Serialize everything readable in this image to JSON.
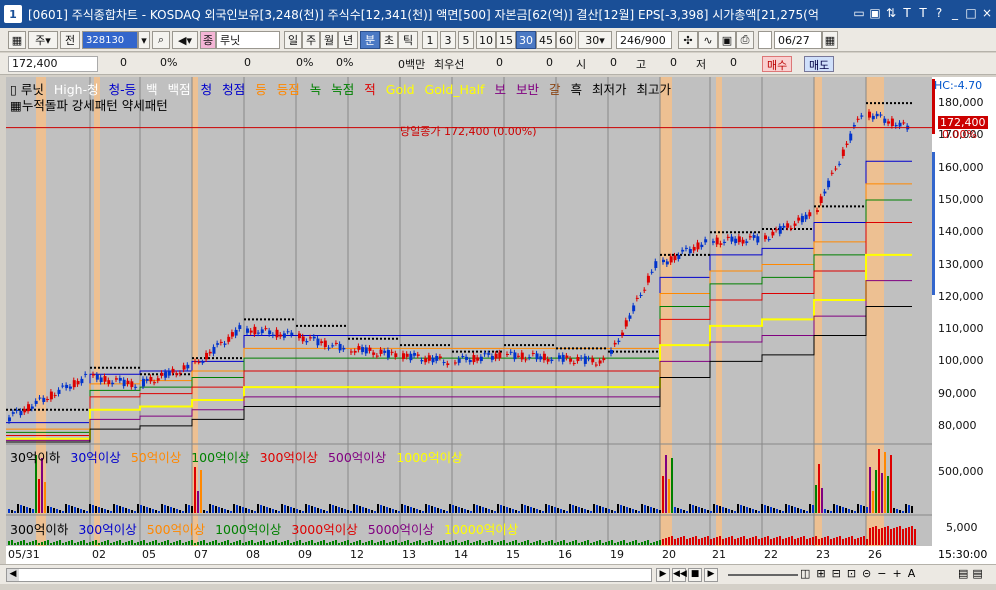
{
  "window": {
    "number": "1",
    "title": "[0601] 주식종합차트 - KOSDAQ 외국인보유[3,248(천)] 주식수[12,341(천)] 액면[500] 자본금[62(억)] 결산[12월] EPS[-3,398] 시가총액[21,275(억",
    "controls": [
      "▭",
      "▣",
      "⇅",
      "T",
      "T",
      "?",
      "_",
      "□",
      "×"
    ]
  },
  "toolbar": {
    "market": "주",
    "prev": "전",
    "code": "328130",
    "name": "루닛",
    "name_badge": "종",
    "periods": [
      "일",
      "주",
      "월",
      "년",
      "분",
      "초",
      "틱"
    ],
    "active_period": "분",
    "intervals": [
      "1",
      "3",
      "5",
      "10",
      "15",
      "30",
      "45",
      "60"
    ],
    "active_interval": "30",
    "interval_value": "30",
    "count": "246/900",
    "date": "06/27"
  },
  "inforow": {
    "price": "172,400",
    "change": "0",
    "change_pct": "0%",
    "v2": "0",
    "v2_pct": "0%",
    "v3_pct": "0%",
    "amount": "0백만",
    "priority": "최우선",
    "bid": "0",
    "ask": "0",
    "open_label": "시",
    "open": "0",
    "high_label": "고",
    "high": "0",
    "low_label": "저",
    "low": "0",
    "buy": "매수",
    "sell": "매도"
  },
  "legend_top": [
    {
      "text": "▯ 루닛",
      "color": "#000000"
    },
    {
      "text": "High-청",
      "color": "#ffffff"
    },
    {
      "text": "청-등",
      "color": "#0000cc"
    },
    {
      "text": "백",
      "color": "#ffffff"
    },
    {
      "text": "백점",
      "color": "#ffffff"
    },
    {
      "text": "청",
      "color": "#0000cc"
    },
    {
      "text": "청점",
      "color": "#0000cc"
    },
    {
      "text": "등",
      "color": "#ff8800"
    },
    {
      "text": "등점",
      "color": "#ff8800"
    },
    {
      "text": "녹",
      "color": "#008000"
    },
    {
      "text": "녹점",
      "color": "#008000"
    },
    {
      "text": "적",
      "color": "#dd0000"
    },
    {
      "text": "Gold",
      "color": "#ffff00"
    },
    {
      "text": "Gold_Half",
      "color": "#ffff00"
    },
    {
      "text": "보",
      "color": "#800080"
    },
    {
      "text": "보반",
      "color": "#800080"
    },
    {
      "text": "갈",
      "color": "#8b4513"
    },
    {
      "text": "흑",
      "color": "#000000"
    },
    {
      "text": "최저가",
      "color": "#000000"
    },
    {
      "text": "최고가",
      "color": "#000000"
    }
  ],
  "legend_patterns": "누적돌파 강세패턴 약세패턴",
  "price_line_label": "당일종가 172,400 (0.00%)",
  "axis": {
    "hc": "HC:-4.70",
    "price_tag": "172,400",
    "price_pct": "0.00%",
    "ticks": [
      "180,000",
      "170,000",
      "160,000",
      "150,000",
      "140,000",
      "130,000",
      "120,000",
      "110,000",
      "100,000",
      "90,000",
      "80,000"
    ],
    "vol_tick": "500,000",
    "vol2_tick": "5,000"
  },
  "legend_vol": [
    {
      "text": "30억이하",
      "color": "#000000"
    },
    {
      "text": "30억이상",
      "color": "#0000cc"
    },
    {
      "text": "50억이상",
      "color": "#ff8800"
    },
    {
      "text": "100억이상",
      "color": "#008000"
    },
    {
      "text": "300억이상",
      "color": "#dd0000"
    },
    {
      "text": "500억이상",
      "color": "#800080"
    },
    {
      "text": "1000억이상",
      "color": "#ffff00"
    }
  ],
  "legend_vol2": [
    {
      "text": "300억이하",
      "color": "#000000"
    },
    {
      "text": "300억이상",
      "color": "#0000cc"
    },
    {
      "text": "500억이상",
      "color": "#ff8800"
    },
    {
      "text": "1000억이상",
      "color": "#008000"
    },
    {
      "text": "3000억이상",
      "color": "#dd0000"
    },
    {
      "text": "5000억이상",
      "color": "#800080"
    },
    {
      "text": "10000억이상",
      "color": "#ffff00"
    }
  ],
  "xaxis": {
    "labels": [
      "05/31",
      "02",
      "05",
      "07",
      "08",
      "09",
      "12",
      "13",
      "14",
      "15",
      "16",
      "19",
      "20",
      "21",
      "22",
      "23",
      "26"
    ],
    "time": "15:30:00"
  },
  "chart_data": {
    "type": "candlestick",
    "x_labels": [
      "05/31",
      "02",
      "05",
      "07",
      "08",
      "09",
      "12",
      "13",
      "14",
      "15",
      "16",
      "19",
      "20",
      "21",
      "22",
      "23",
      "26"
    ],
    "ylim": [
      75000,
      185000
    ],
    "close_line": 172400,
    "close_segments": [
      82000,
      95000,
      93000,
      98000,
      110000,
      108000,
      104000,
      102000,
      100000,
      102000,
      101000,
      100000,
      130000,
      137000,
      138000,
      145000,
      177000,
      172400
    ],
    "channel_levels": [
      {
        "color": "#0000cc",
        "values": [
          81000,
          96000,
          97000,
          100000,
          108000,
          108000,
          108000,
          108000,
          108000,
          108000,
          108000,
          108000,
          126000,
          133000,
          135000,
          143000,
          162000
        ]
      },
      {
        "color": "#ff8800",
        "values": [
          79000,
          93000,
          94000,
          97000,
          104000,
          104000,
          104000,
          104000,
          104000,
          104000,
          104000,
          104000,
          121000,
          128000,
          130000,
          137000,
          155000
        ]
      },
      {
        "color": "#008000",
        "values": [
          78000,
          91000,
          92000,
          95000,
          101000,
          101000,
          101000,
          101000,
          101000,
          101000,
          101000,
          101000,
          117000,
          124000,
          126000,
          133000,
          150000
        ]
      },
      {
        "color": "#dd0000",
        "values": [
          77000,
          89000,
          90000,
          92000,
          97000,
          97000,
          97000,
          97000,
          97000,
          97000,
          97000,
          97000,
          113000,
          119000,
          121000,
          128000,
          143000
        ]
      },
      {
        "color": "#ffff00",
        "values": [
          76000,
          85000,
          86000,
          88000,
          92000,
          92000,
          92000,
          92000,
          92000,
          92000,
          92000,
          92000,
          105000,
          111000,
          113000,
          119000,
          133000
        ]
      },
      {
        "color": "#800080",
        "values": [
          75500,
          82000,
          83000,
          85000,
          89000,
          89000,
          89000,
          89000,
          89000,
          89000,
          89000,
          89000,
          100000,
          106000,
          108000,
          114000,
          125000
        ]
      },
      {
        "color": "#000000",
        "values": [
          75000,
          79000,
          80000,
          82000,
          86000,
          86000,
          86000,
          86000,
          86000,
          86000,
          86000,
          86000,
          95000,
          100000,
          102000,
          108000,
          117000
        ]
      }
    ],
    "highlight_days": [
      "05/31",
      "02",
      "07",
      "20",
      "21",
      "23",
      "26"
    ]
  }
}
